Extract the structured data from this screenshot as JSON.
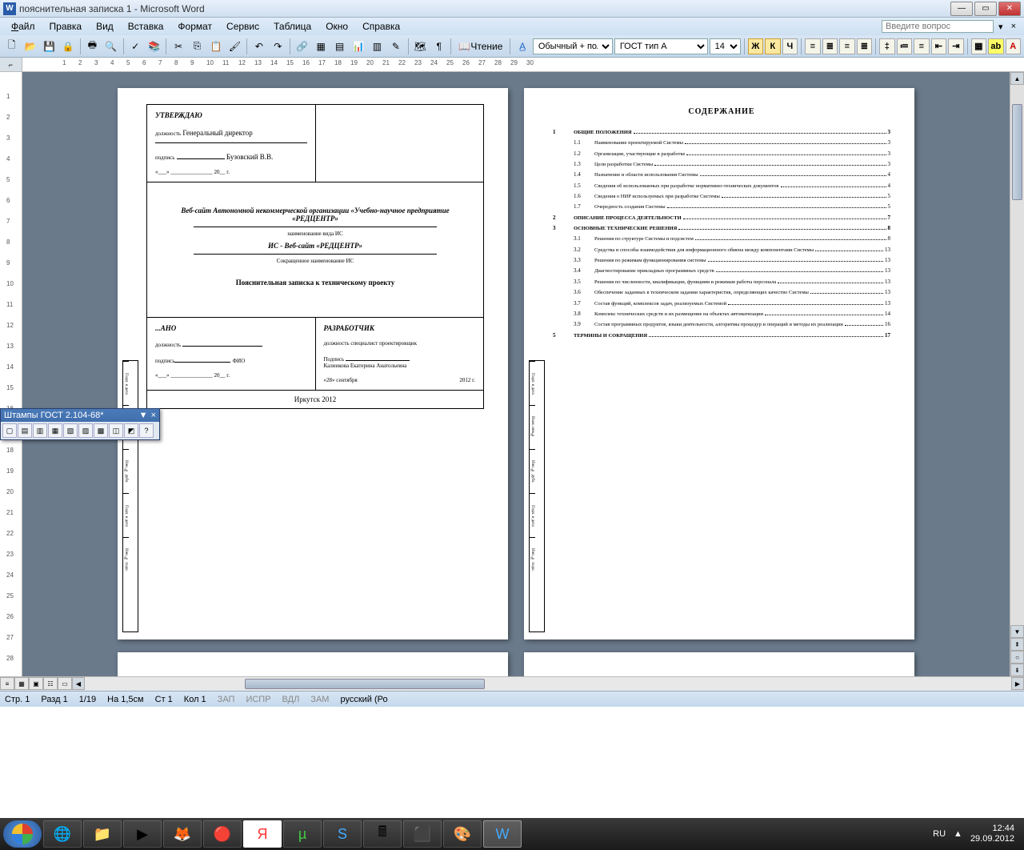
{
  "titlebar": {
    "icon_text": "W",
    "title": "пояснительная записка 1 - Microsoft Word"
  },
  "menus": {
    "file": "Файл",
    "edit": "Правка",
    "view": "Вид",
    "insert": "Вставка",
    "format": "Формат",
    "service": "Сервис",
    "table": "Таблица",
    "window": "Окно",
    "help": "Справка"
  },
  "help_placeholder": "Введите вопрос",
  "toolbar": {
    "reading": "Чтение",
    "style_combo": "Обычный + полу",
    "font_combo": "ГОСТ тип А",
    "size_combo": "14",
    "bold": "Ж",
    "italic": "К",
    "underline": "Ч"
  },
  "ruler_corner": "⌐",
  "page1": {
    "approve": "УТВЕРЖДАЮ",
    "position_label": "должность",
    "position_value": "Генеральный директор",
    "sign_label": "подпись",
    "sign_name": "Бузовский В.В.",
    "date_line": "«___» _______________ 20__ г.",
    "title1": "Веб-сайт Автономной некоммерческой организации «Учебно-научное предприятие «РЕДЦЕНТР»",
    "sub1": "наименование вида ИС",
    "title2": "ИС - Веб-сайт «РЕДЦЕНТР»",
    "sub2": "Сокращенное наименование ИС",
    "main_title": "Пояснительная записка к техническому проекту",
    "agreed": "...АНО",
    "fio": "ФИО",
    "date_line2": "«___» _______________ 20__ г.",
    "developer": "РАЗРАБОТЧИК",
    "dev_position": "должность  специалист проектировщик",
    "dev_sign_label": "Подпись",
    "dev_name": "Калинкова Екатерина Анатольевна",
    "dev_date": "«28» сентября",
    "dev_year": "2012 г.",
    "footer": "Иркутск  2012"
  },
  "stamp_labels": [
    "Подп. и дата",
    "Взам. инв.№",
    "Инв. № дубл.",
    "Подп. и дата",
    "Инв. № подл."
  ],
  "toc": {
    "title": "СОДЕРЖАНИЕ",
    "items": [
      {
        "n": "1",
        "t": "ОБЩИЕ ПОЛОЖЕНИЯ",
        "p": "3",
        "main": true
      },
      {
        "n": "1.1",
        "t": "Наименование проектируемой Системы",
        "p": "3"
      },
      {
        "n": "1.2",
        "t": "Организации, участвующие в разработке",
        "p": "3"
      },
      {
        "n": "1.3",
        "t": "Цели разработки Системы",
        "p": "3"
      },
      {
        "n": "1.4",
        "t": "Назначение и области использования Системы",
        "p": "4"
      },
      {
        "n": "1.5",
        "t": "Сведения об использованных при разработке нормативно-технических документов",
        "p": "4"
      },
      {
        "n": "1.6",
        "t": "Сведения о НИР используемых при разработке Системы",
        "p": "5"
      },
      {
        "n": "1.7",
        "t": "Очередность создания Системы",
        "p": "5"
      },
      {
        "n": "2",
        "t": "ОПИСАНИЕ ПРОЦЕССА ДЕЯТЕЛЬНОСТИ",
        "p": "7",
        "main": true
      },
      {
        "n": "3",
        "t": "ОСНОВНЫЕ ТЕХНИЧЕСКИЕ РЕШЕНИЯ",
        "p": "8",
        "main": true
      },
      {
        "n": "3.1",
        "t": "Решения по структуре Системы и подсистем",
        "p": "8"
      },
      {
        "n": "3.2",
        "t": "Средства и способы взаимодействия для информационного обмена между компонентами Системы",
        "p": "13"
      },
      {
        "n": "3.3",
        "t": "Решения по режимам функционирования системы",
        "p": "13"
      },
      {
        "n": "3.4",
        "t": "Диагностирование прикладных программных средств",
        "p": "13"
      },
      {
        "n": "3.5",
        "t": "Решения по численности, квалификации, функциям и режимам работы персонала",
        "p": "13"
      },
      {
        "n": "3.6",
        "t": "Обеспечение заданных в техническом задании характеристик, определяющих качество Системы",
        "p": "13"
      },
      {
        "n": "3.7",
        "t": "Состав функций, комплексов задач, реализуемых Системой",
        "p": "13"
      },
      {
        "n": "3.8",
        "t": "Комплекс технических средств и их размещение на объектах автоматизации",
        "p": "14"
      },
      {
        "n": "3.9",
        "t": "Состав программных продуктов, языки деятельности, алгоритмы процедур и операций и методы их реализации",
        "p": "16"
      },
      {
        "n": "5",
        "t": "ТЕРМИНЫ И СОКРАЩЕНИЯ",
        "p": "17",
        "main": true
      }
    ]
  },
  "float": {
    "title": "Штампы ГОСТ 2.104-68*"
  },
  "status": {
    "page": "Стр. 1",
    "section": "Разд 1",
    "pages": "1/19",
    "at": "На 1,5см",
    "line": "Ст 1",
    "col": "Кол 1",
    "rec": "ЗАП",
    "ispr": "ИСПР",
    "vdl": "ВДЛ",
    "zam": "ЗАМ",
    "lang": "русский (Ро"
  },
  "tray": {
    "lang": "RU",
    "time": "12:44",
    "date": "29.09.2012"
  }
}
